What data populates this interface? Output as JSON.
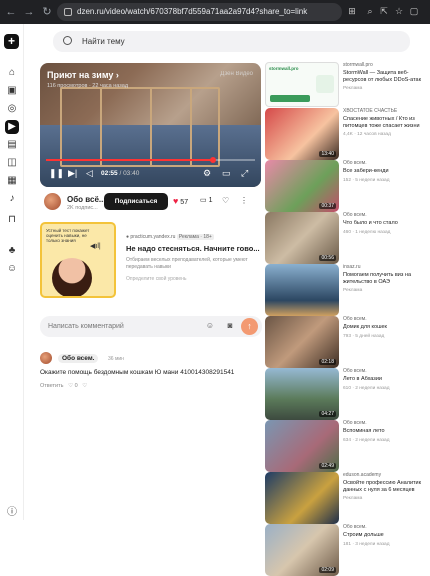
{
  "browser": {
    "url": "dzen.ru/video/watch/670378bf7d559a71aa2a97d4?share_to=link",
    "back_icon": "arrow-left-icon",
    "forward_icon": "arrow-right-icon",
    "reload_icon": "reload-icon"
  },
  "search": {
    "placeholder": "Найти тему"
  },
  "video": {
    "title": "Приют на зиму",
    "meta": "116 просмотров · 22 часа назад",
    "watermark": "Дзен Видео",
    "current_time": "02:55",
    "duration": "03:40",
    "progress": 0.8
  },
  "channel": {
    "name": "Обо всё...",
    "subscribers": "2K подпис...",
    "subscribe_label": "Подписаться",
    "likes": "57",
    "comments_count": "1"
  },
  "ad_main": {
    "thumb_text": "Устный тест покажет оценить навыки, не только знания",
    "source": "practicum.yandex.ru",
    "badge": "Реклама · 18+",
    "title": "Не надо стесняться. Начните гово...",
    "description": "Отбираем веселых преподавателей, которые умеют передавать навыки",
    "link": "Определите свой уровень"
  },
  "comment_input": {
    "placeholder": "Написать комментарий"
  },
  "comment": {
    "author": "Обо всем.",
    "time": "36 мин",
    "text": "Окажите помощь бездомным кошкам Ю мани 4100143082915​41",
    "reply": "Ответить",
    "likes": "0"
  },
  "sidebar_cards": [
    {
      "source": "stormwall.pro",
      "title": "StormWall — Защита веб-ресурсов от любых DDoS-атак",
      "stats": "Реклама",
      "duration": "",
      "ad": true
    },
    {
      "source": "ХВОСТАТОЕ СЧАСТЬЕ",
      "title": "Спасение животных / Кто из питомцев тоже спасает жизни",
      "stats": "4,4K · 12 часов назад",
      "duration": "13:40",
      "ad": false
    },
    {
      "source": "Обо всем.",
      "title": "Все забери-кенди",
      "stats": "152 · 5 недели назад",
      "duration": "00:37",
      "ad": false
    },
    {
      "source": "Обо всем.",
      "title": "Что было и что стало",
      "stats": "460 · 1 неделю назад",
      "duration": "00:56",
      "ad": false
    },
    {
      "source": "insaz.ru",
      "title": "Помогаем получить виз на жительство в ОАЭ",
      "stats": "Реклама",
      "duration": "",
      "ad": true
    },
    {
      "source": "Обо всем.",
      "title": "Домик для кошек",
      "stats": "793 · 5 дней назад",
      "duration": "02:18",
      "ad": false
    },
    {
      "source": "Обо всем.",
      "title": "Лето в Абхазии",
      "stats": "610 · 2 недели назад",
      "duration": "04:27",
      "ad": false
    },
    {
      "source": "Обо всем.",
      "title": "Вспоминая лето",
      "stats": "634 · 2 недели назад",
      "duration": "02:49",
      "ad": false
    },
    {
      "source": "eduson.academy",
      "title": "Освойте профессию Аналитик данных с нуля за 6 месяцев",
      "stats": "Реклама",
      "duration": "",
      "ad": true
    },
    {
      "source": "Обо всем.",
      "title": "Строим дольше",
      "stats": "181 · 3 недели назад",
      "duration": "02:09",
      "ad": false
    }
  ],
  "colors": {
    "accent": "#f33",
    "subscribe_bg": "#1a1a1a",
    "ad_border": "#f3c33a",
    "send": "#f39a72"
  }
}
